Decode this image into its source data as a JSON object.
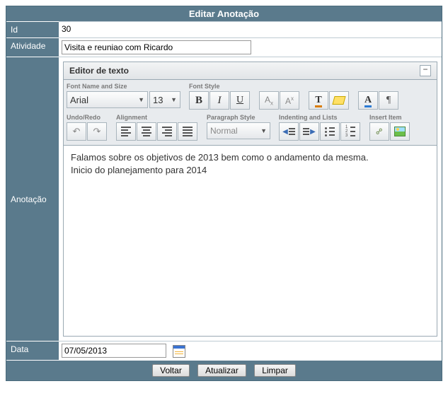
{
  "title": "Editar Anotação",
  "fields": {
    "id_label": "Id",
    "id_value": "30",
    "atividade_label": "Atividade",
    "atividade_value": "Visita e reuniao com Ricardo",
    "anotacao_label": "Anotação",
    "data_label": "Data",
    "data_value": "07/05/2013"
  },
  "editor": {
    "title": "Editor de texto",
    "group_font": "Font Name and Size",
    "group_style": "Font Style",
    "group_undo": "Undo/Redo",
    "group_align": "Alignment",
    "group_para": "Paragraph Style",
    "group_indent": "Indenting and Lists",
    "group_insert": "Insert Item",
    "font_name": "Arial",
    "font_size": "13",
    "para_value": "Normal",
    "bold": "B",
    "italic": "I",
    "underline": "U",
    "content_line1": "Falamos sobre os objetivos de 2013 bem como o andamento da mesma.",
    "content_line2": "Inicio do planejamento para 2014"
  },
  "buttons": {
    "voltar": "Voltar",
    "atualizar": "Atualizar",
    "limpar": "Limpar"
  }
}
